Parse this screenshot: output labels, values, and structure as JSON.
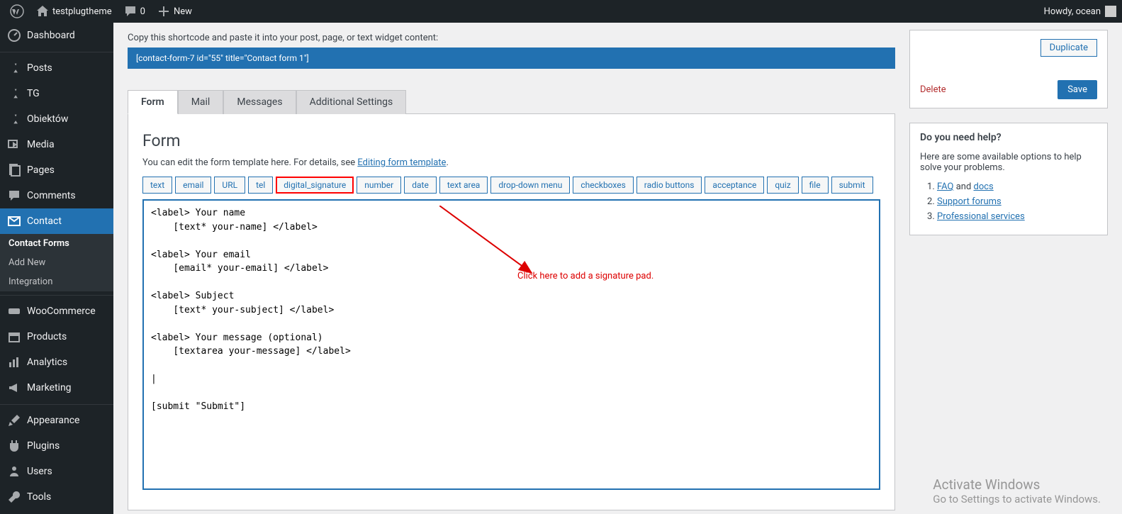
{
  "topbar": {
    "site_name": "testplugtheme",
    "comments_count": "0",
    "new_label": "New",
    "howdy": "Howdy, ocean"
  },
  "sidebar": {
    "items": [
      {
        "label": "Dashboard"
      },
      {
        "label": "Posts"
      },
      {
        "label": "TG"
      },
      {
        "label": "Obiektów"
      },
      {
        "label": "Media"
      },
      {
        "label": "Pages"
      },
      {
        "label": "Comments"
      },
      {
        "label": "Contact"
      },
      {
        "label": "WooCommerce"
      },
      {
        "label": "Products"
      },
      {
        "label": "Analytics"
      },
      {
        "label": "Marketing"
      },
      {
        "label": "Appearance"
      },
      {
        "label": "Plugins"
      },
      {
        "label": "Users"
      },
      {
        "label": "Tools"
      }
    ],
    "submenu": {
      "contact_forms": "Contact Forms",
      "add_new": "Add New",
      "integration": "Integration"
    }
  },
  "content": {
    "shortcode_hint": "Copy this shortcode and paste it into your post, page, or text widget content:",
    "shortcode": "[contact-form-7 id=\"55\" title=\"Contact form 1\"]",
    "tabs": [
      "Form",
      "Mail",
      "Messages",
      "Additional Settings"
    ],
    "form_heading": "Form",
    "form_desc_prefix": "You can edit the form template here. For details, see ",
    "form_desc_link": "Editing form template",
    "form_desc_suffix": ".",
    "tag_buttons": [
      "text",
      "email",
      "URL",
      "tel",
      "digital_signature",
      "number",
      "date",
      "text area",
      "drop-down menu",
      "checkboxes",
      "radio buttons",
      "acceptance",
      "quiz",
      "file",
      "submit"
    ],
    "form_code": "<label> Your name\n    [text* your-name] </label>\n\n<label> Your email\n    [email* your-email] </label>\n\n<label> Subject\n    [text* your-subject] </label>\n\n<label> Your message (optional)\n    [textarea your-message] </label>\n\n|\n\n[submit \"Submit\"]",
    "annotation_text": "Click here to add a signature pad."
  },
  "right": {
    "duplicate": "Duplicate",
    "delete": "Delete",
    "save": "Save",
    "help_title": "Do you need help?",
    "help_text": "Here are some available options to help solve your problems.",
    "help_links": [
      {
        "link": "FAQ",
        "suffix": " and ",
        "link2": "docs"
      },
      {
        "link": "Support forums"
      },
      {
        "link": "Professional services"
      }
    ]
  },
  "watermark": {
    "title": "Activate Windows",
    "sub": "Go to Settings to activate Windows."
  }
}
